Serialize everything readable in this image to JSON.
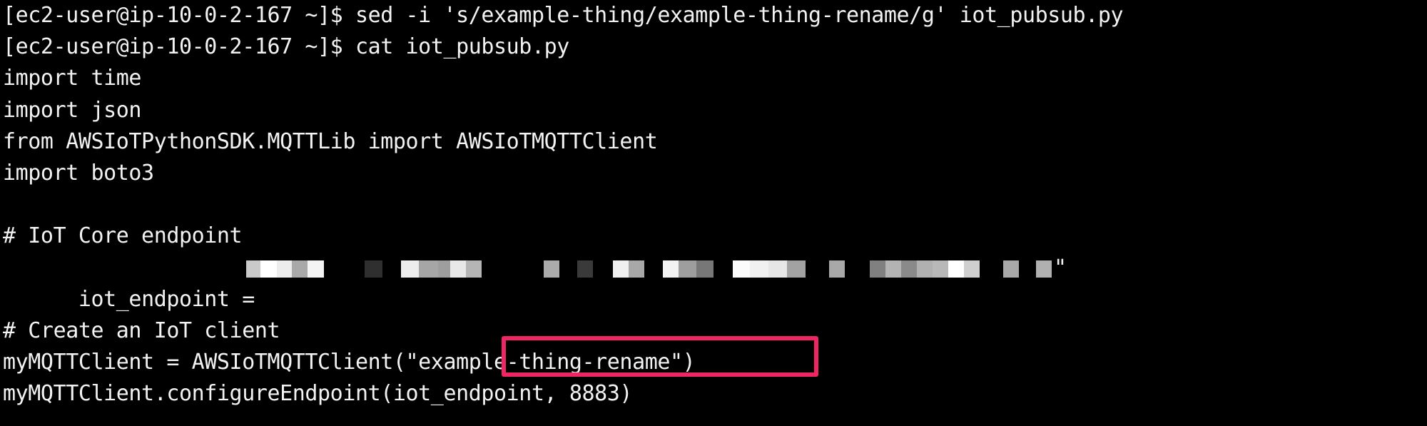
{
  "terminal": {
    "background_color": "#000000",
    "text_color": "#f2f2f2",
    "highlight_color": "#ee2764",
    "prompt": "[ec2-user@ip-10-0-2-167 ~]$",
    "hostname": "ip-10-0-2-167",
    "user": "ec2-user",
    "cwd": "~",
    "lines": [
      {
        "id": "cmd-sed",
        "text": "[ec2-user@ip-10-0-2-167 ~]$ sed -i 's/example-thing/example-thing-rename/g' iot_pubsub.py"
      },
      {
        "id": "cmd-cat",
        "text": "[ec2-user@ip-10-0-2-167 ~]$ cat iot_pubsub.py"
      },
      {
        "id": "code-import-time",
        "text": "import time"
      },
      {
        "id": "code-import-json",
        "text": "import json"
      },
      {
        "id": "code-from-awsiot",
        "text": "from AWSIoTPythonSDK.MQTTLib import AWSIoTMQTTClient"
      },
      {
        "id": "code-import-boto3",
        "text": "import boto3"
      },
      {
        "id": "blank-1",
        "text": ""
      },
      {
        "id": "comment-endpoint",
        "text": "# IoT Core endpoint"
      },
      {
        "id": "code-iot-endpoint",
        "text": "iot_endpoint = "
      },
      {
        "id": "blank-2",
        "text": ""
      },
      {
        "id": "comment-create-client",
        "text": "# Create an IoT client"
      },
      {
        "id": "code-mqtt-client",
        "text": "myMQTTClient = AWSIoTMQTTClient(\"example-thing-rename\")"
      },
      {
        "id": "code-configure-endpoint",
        "text": "myMQTTClient.configureEndpoint(iot_endpoint, 8883)"
      }
    ],
    "commands": {
      "sed_command": "sed -i 's/example-thing/example-thing-rename/g' iot_pubsub.py",
      "cat_command": "cat iot_pubsub.py",
      "filename": "iot_pubsub.py",
      "sed_pattern": "s/example-thing/example-thing-rename/g",
      "old_thing_name": "example-thing",
      "new_thing_name": "example-thing-rename"
    },
    "endpoint_line": {
      "prefix": "iot_endpoint = ",
      "redacted": true,
      "redaction_note": "",
      "closing_quote": "\""
    },
    "highlight": {
      "target_text": "\"example-thing-rename\"",
      "color": "#ee2764"
    },
    "mqtt": {
      "client_var": "myMQTTClient",
      "client_class": "AWSIoTMQTTClient",
      "client_id": "example-thing-rename",
      "configure_method": "configureEndpoint",
      "endpoint_var": "iot_endpoint",
      "port": "8883"
    }
  }
}
